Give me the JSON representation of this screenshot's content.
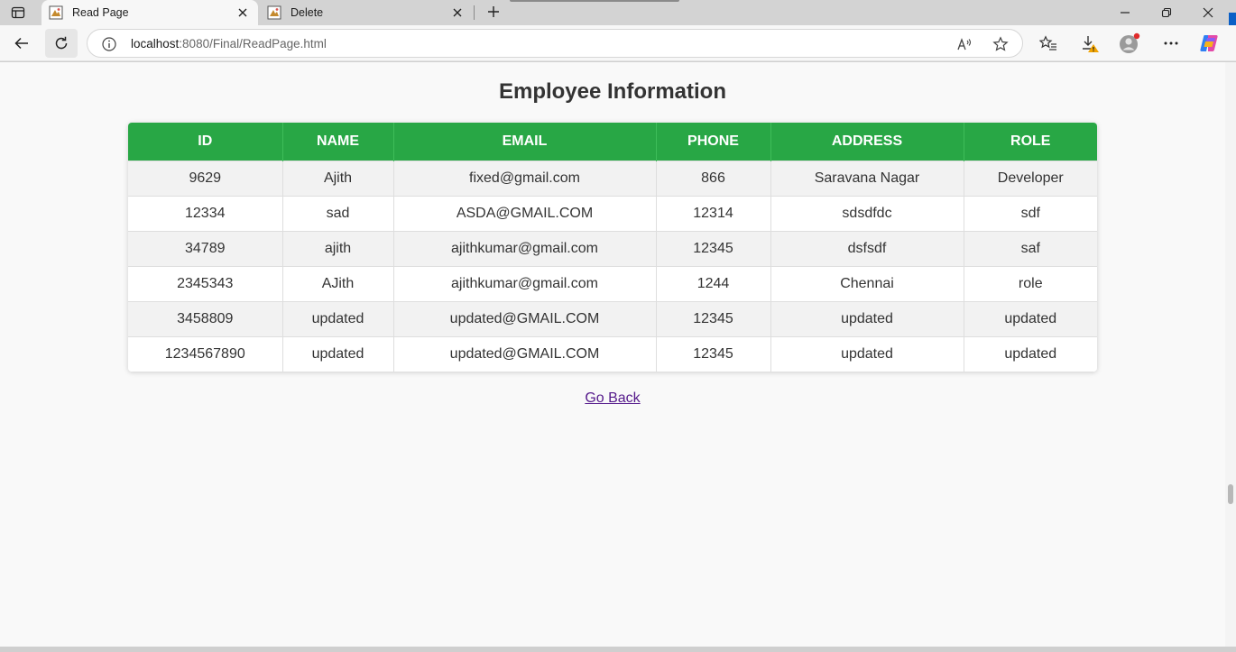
{
  "browser": {
    "tabs": [
      {
        "title": "Read Page",
        "active": true
      },
      {
        "title": "Delete",
        "active": false
      }
    ],
    "url_host": "localhost",
    "url_path": ":8080/Final/ReadPage.html"
  },
  "page": {
    "title": "Employee Information",
    "columns": [
      "ID",
      "NAME",
      "EMAIL",
      "PHONE",
      "ADDRESS",
      "ROLE"
    ],
    "rows": [
      [
        "9629",
        "Ajith",
        "fixed@gmail.com",
        "866",
        "Saravana Nagar",
        "Developer"
      ],
      [
        "12334",
        "sad",
        "ASDA@GMAIL.COM",
        "12314",
        "sdsdfdc",
        "sdf"
      ],
      [
        "34789",
        "ajith",
        "ajithkumar@gmail.com",
        "12345",
        "dsfsdf",
        "saf"
      ],
      [
        "2345343",
        "AJith",
        "ajithkumar@gmail.com",
        "1244",
        "Chennai",
        "role"
      ],
      [
        "3458809",
        "updated",
        "updated@GMAIL.COM",
        "12345",
        "updated",
        "updated"
      ],
      [
        "1234567890",
        "updated",
        "updated@GMAIL.COM",
        "12345",
        "updated",
        "updated"
      ]
    ],
    "go_back_label": "Go Back"
  },
  "colors": {
    "header_green": "#28a745",
    "link_visited": "#551a8b"
  },
  "icons": [
    "tab-actions-icon",
    "page-favicon-icon",
    "close-icon",
    "new-tab-icon",
    "minimize-icon",
    "restore-icon",
    "window-close-icon",
    "back-arrow-icon",
    "reload-icon",
    "info-icon",
    "read-aloud-icon",
    "favorite-star-icon",
    "favorites-icon",
    "downloads-icon",
    "profile-icon",
    "more-icon",
    "copilot-icon"
  ]
}
